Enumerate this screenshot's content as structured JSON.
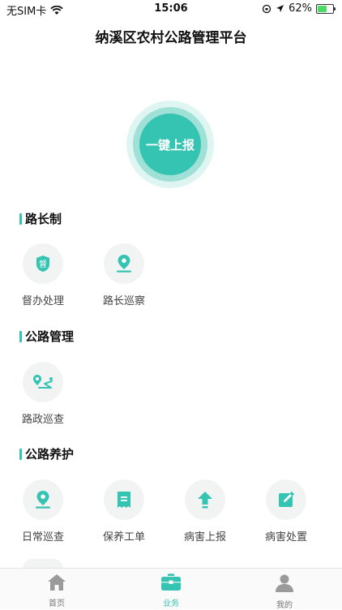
{
  "status": {
    "carrier": "无SIM卡",
    "time": "15:06",
    "battery": "62%",
    "battery_level": 0.62
  },
  "header": {
    "title": "纳溪区农村公路管理平台"
  },
  "report_button": {
    "label": "一键上报"
  },
  "sections": [
    {
      "title": "路长制",
      "items": [
        {
          "label": "督办处理",
          "icon": "supervise-badge-icon",
          "badge_char": "督"
        },
        {
          "label": "路长巡察",
          "icon": "location-pin-icon"
        }
      ]
    },
    {
      "title": "公路管理",
      "items": [
        {
          "label": "路政巡查",
          "icon": "map-route-icon"
        }
      ]
    },
    {
      "title": "公路养护",
      "items": [
        {
          "label": "日常巡查",
          "icon": "location-pin-icon"
        },
        {
          "label": "保养工单",
          "icon": "receipt-icon"
        },
        {
          "label": "病害上报",
          "icon": "upload-arrow-icon"
        },
        {
          "label": "病害处置",
          "icon": "edit-icon"
        }
      ]
    }
  ],
  "tabbar": {
    "tabs": [
      {
        "label": "首页",
        "icon": "home-icon",
        "active": false
      },
      {
        "label": "业务",
        "icon": "briefcase-icon",
        "active": true
      },
      {
        "label": "我的",
        "icon": "user-icon",
        "active": false
      }
    ]
  },
  "colors": {
    "accent": "#35c3b2",
    "icon_bg": "#f2f4f4"
  }
}
